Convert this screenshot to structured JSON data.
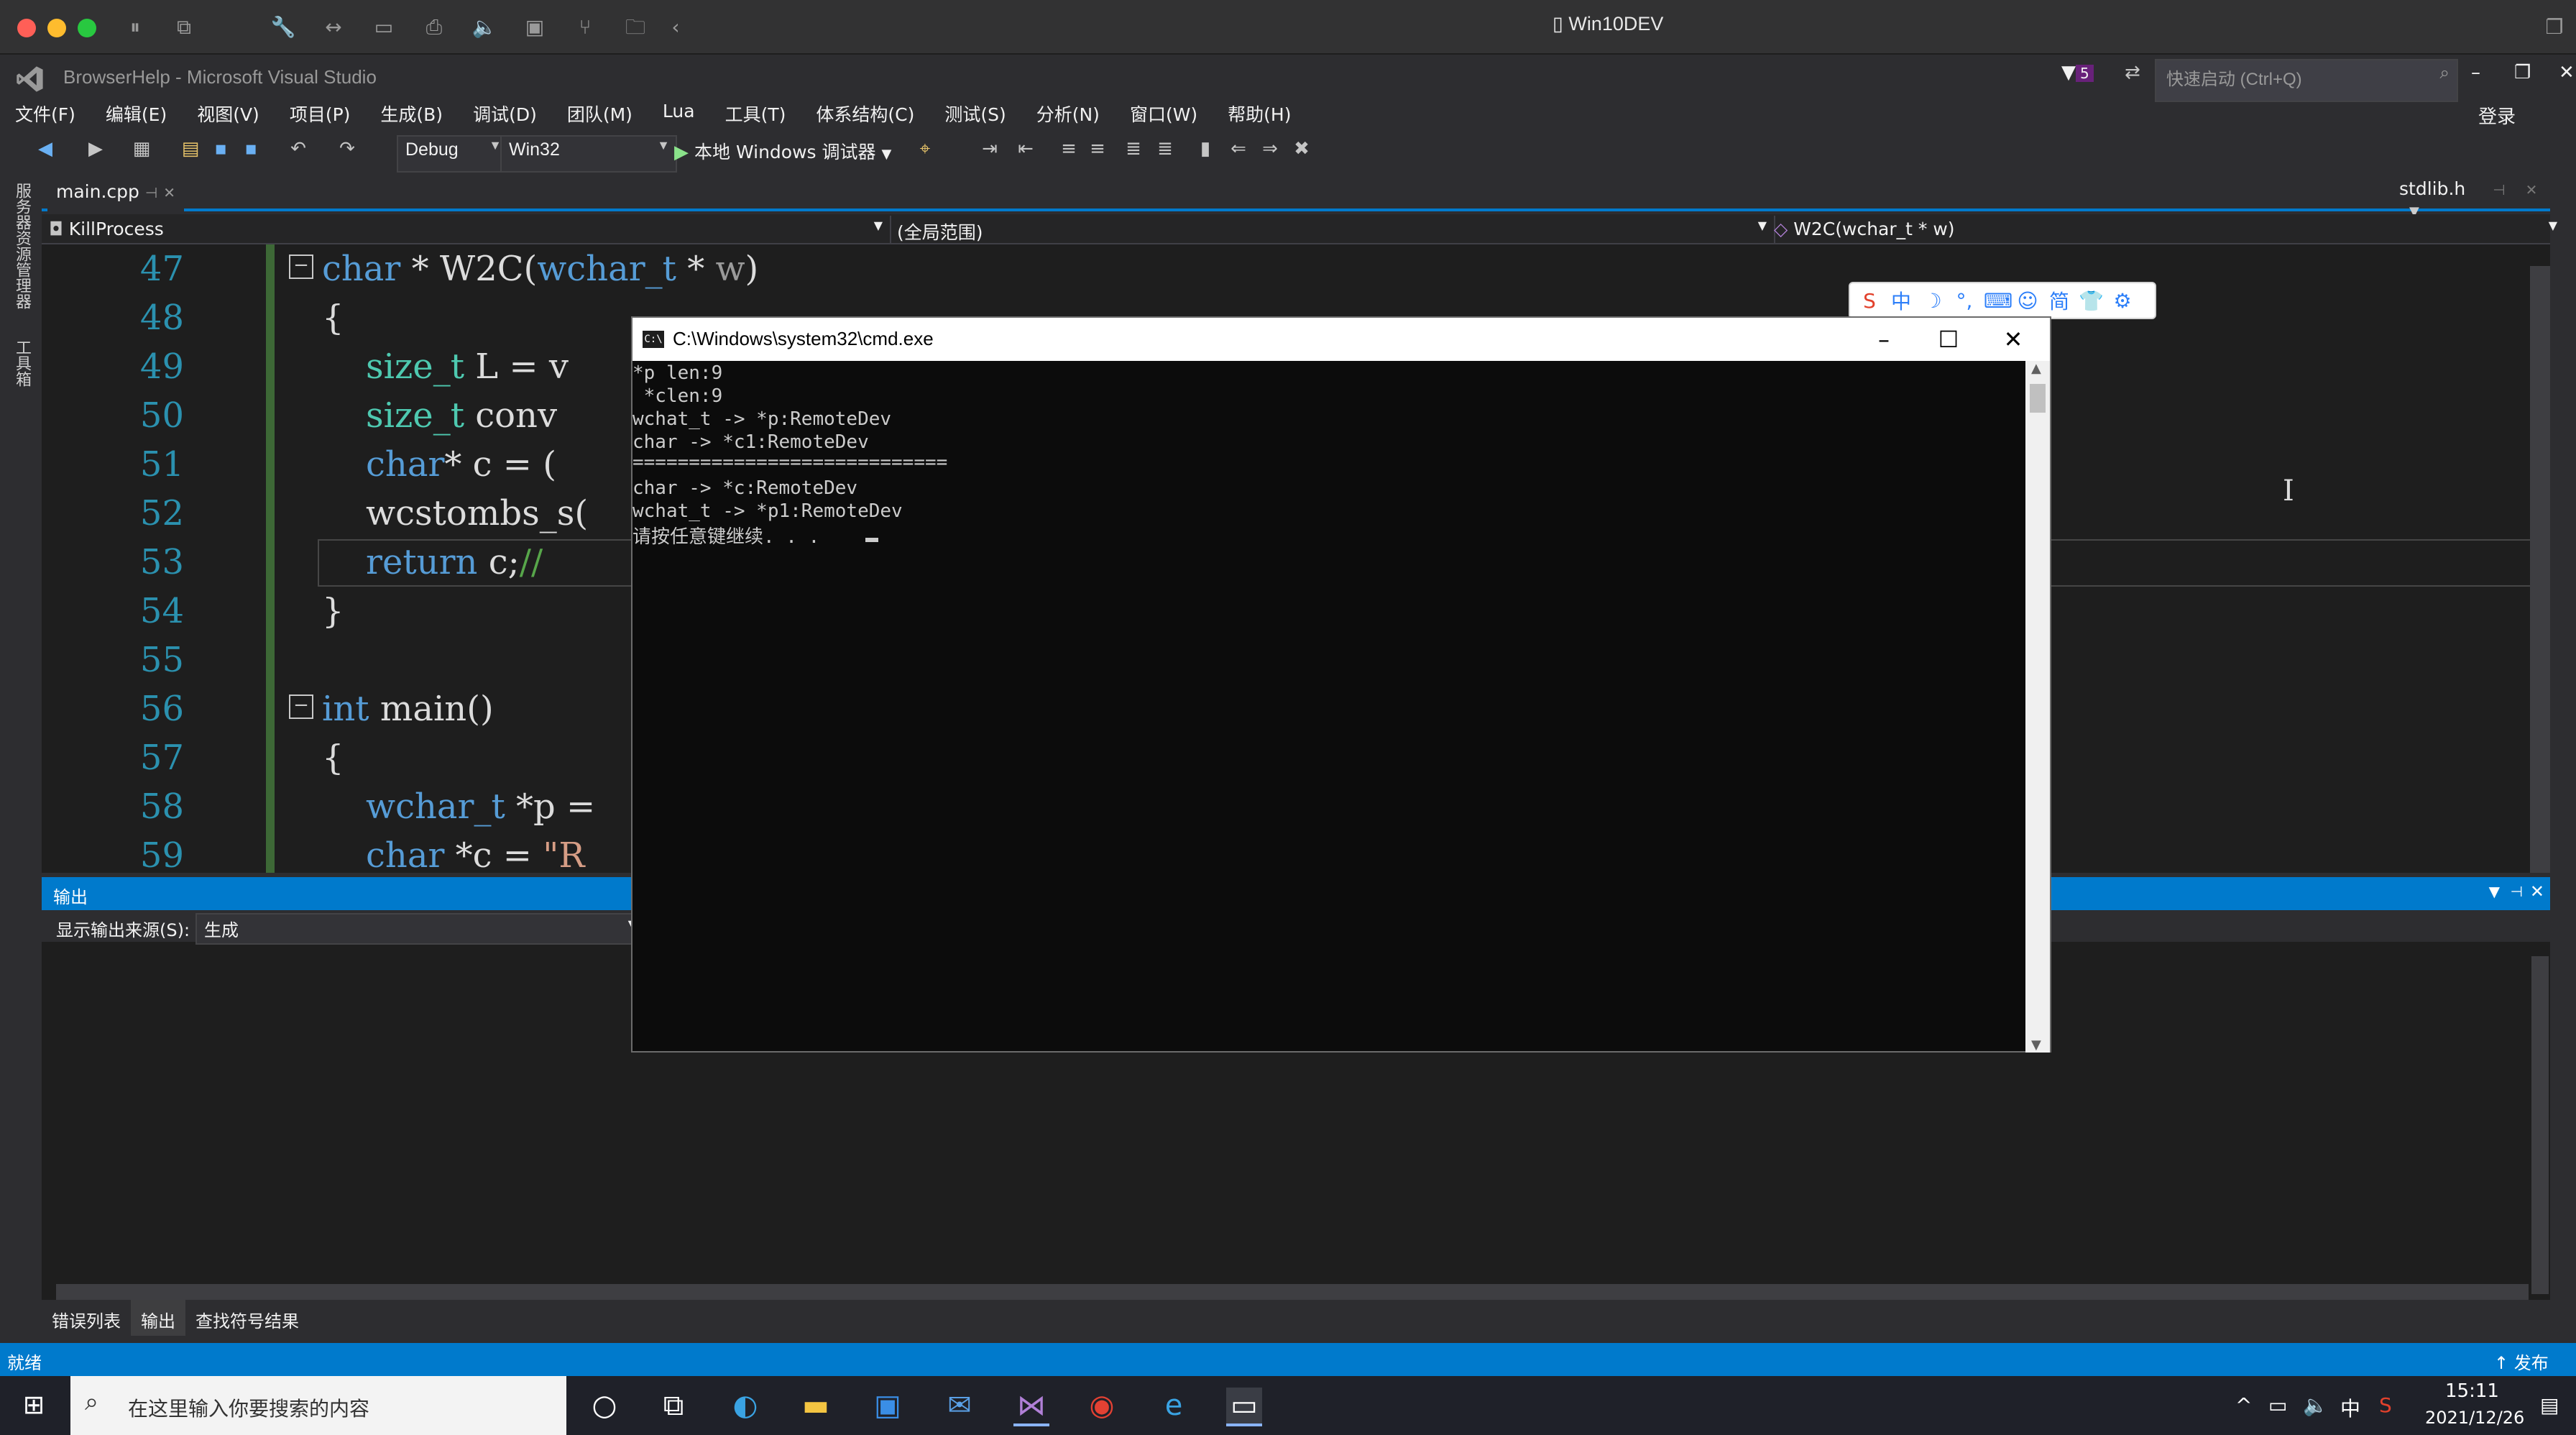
{
  "mac": {
    "title": "Win10DEV"
  },
  "vs": {
    "title": "BrowserHelp - Microsoft Visual Studio",
    "notification_count": "5",
    "quick_launch_placeholder": "快速启动 (Ctrl+Q)",
    "login": "登录",
    "menus": [
      "文件(F)",
      "编辑(E)",
      "视图(V)",
      "项目(P)",
      "生成(B)",
      "调试(D)",
      "团队(M)",
      "Lua",
      "工具(T)",
      "体系结构(C)",
      "测试(S)",
      "分析(N)",
      "窗口(W)",
      "帮助(H)"
    ],
    "toolbar": {
      "config": "Debug",
      "platform": "Win32",
      "run_label": "本地 Windows 调试器"
    },
    "left_strip": [
      "服务器资源管理器",
      "工具箱"
    ]
  },
  "tabs": {
    "active": "main.cpp",
    "right": "stdlib.h"
  },
  "nav": {
    "scope1": "KillProcess",
    "scope2": "(全局范围)",
    "scope3": "W2C(wchar_t * w)"
  },
  "editor": {
    "line_numbers": [
      "47",
      "48",
      "49",
      "50",
      "51",
      "52",
      "53",
      "54",
      "55",
      "56",
      "57",
      "58",
      "59"
    ],
    "lines": [
      "char * W2C(wchar_t * w)",
      "{",
      "    size_t L = v",
      "    size_t conv",
      "    char* c = (",
      "    wcstombs_s(",
      "    return c;//",
      "}",
      "",
      "int main()",
      "{",
      "    wchar_t *p =",
      "    char *c = \"R"
    ]
  },
  "output": {
    "title": "输出",
    "source_label": "显示输出来源(S):",
    "source_value": "生成"
  },
  "bottom_tabs": [
    "错误列表",
    "输出",
    "查找符号结果"
  ],
  "status": {
    "text": "就绪",
    "publish": "发布"
  },
  "cmd": {
    "title": "C:\\Windows\\system32\\cmd.exe",
    "lines": [
      "*p len:9",
      " *clen:9",
      "wchat_t -> *p:RemoteDev",
      "char -> *c1:RemoteDev",
      "============================",
      "char -> *c:RemoteDev",
      "wchat_t -> *p1:RemoteDev",
      "请按任意键继续. . ."
    ]
  },
  "taskbar": {
    "search_placeholder": "在这里输入你要搜索的内容",
    "time": "15:11",
    "date": "2021/12/26",
    "ime": "中"
  }
}
